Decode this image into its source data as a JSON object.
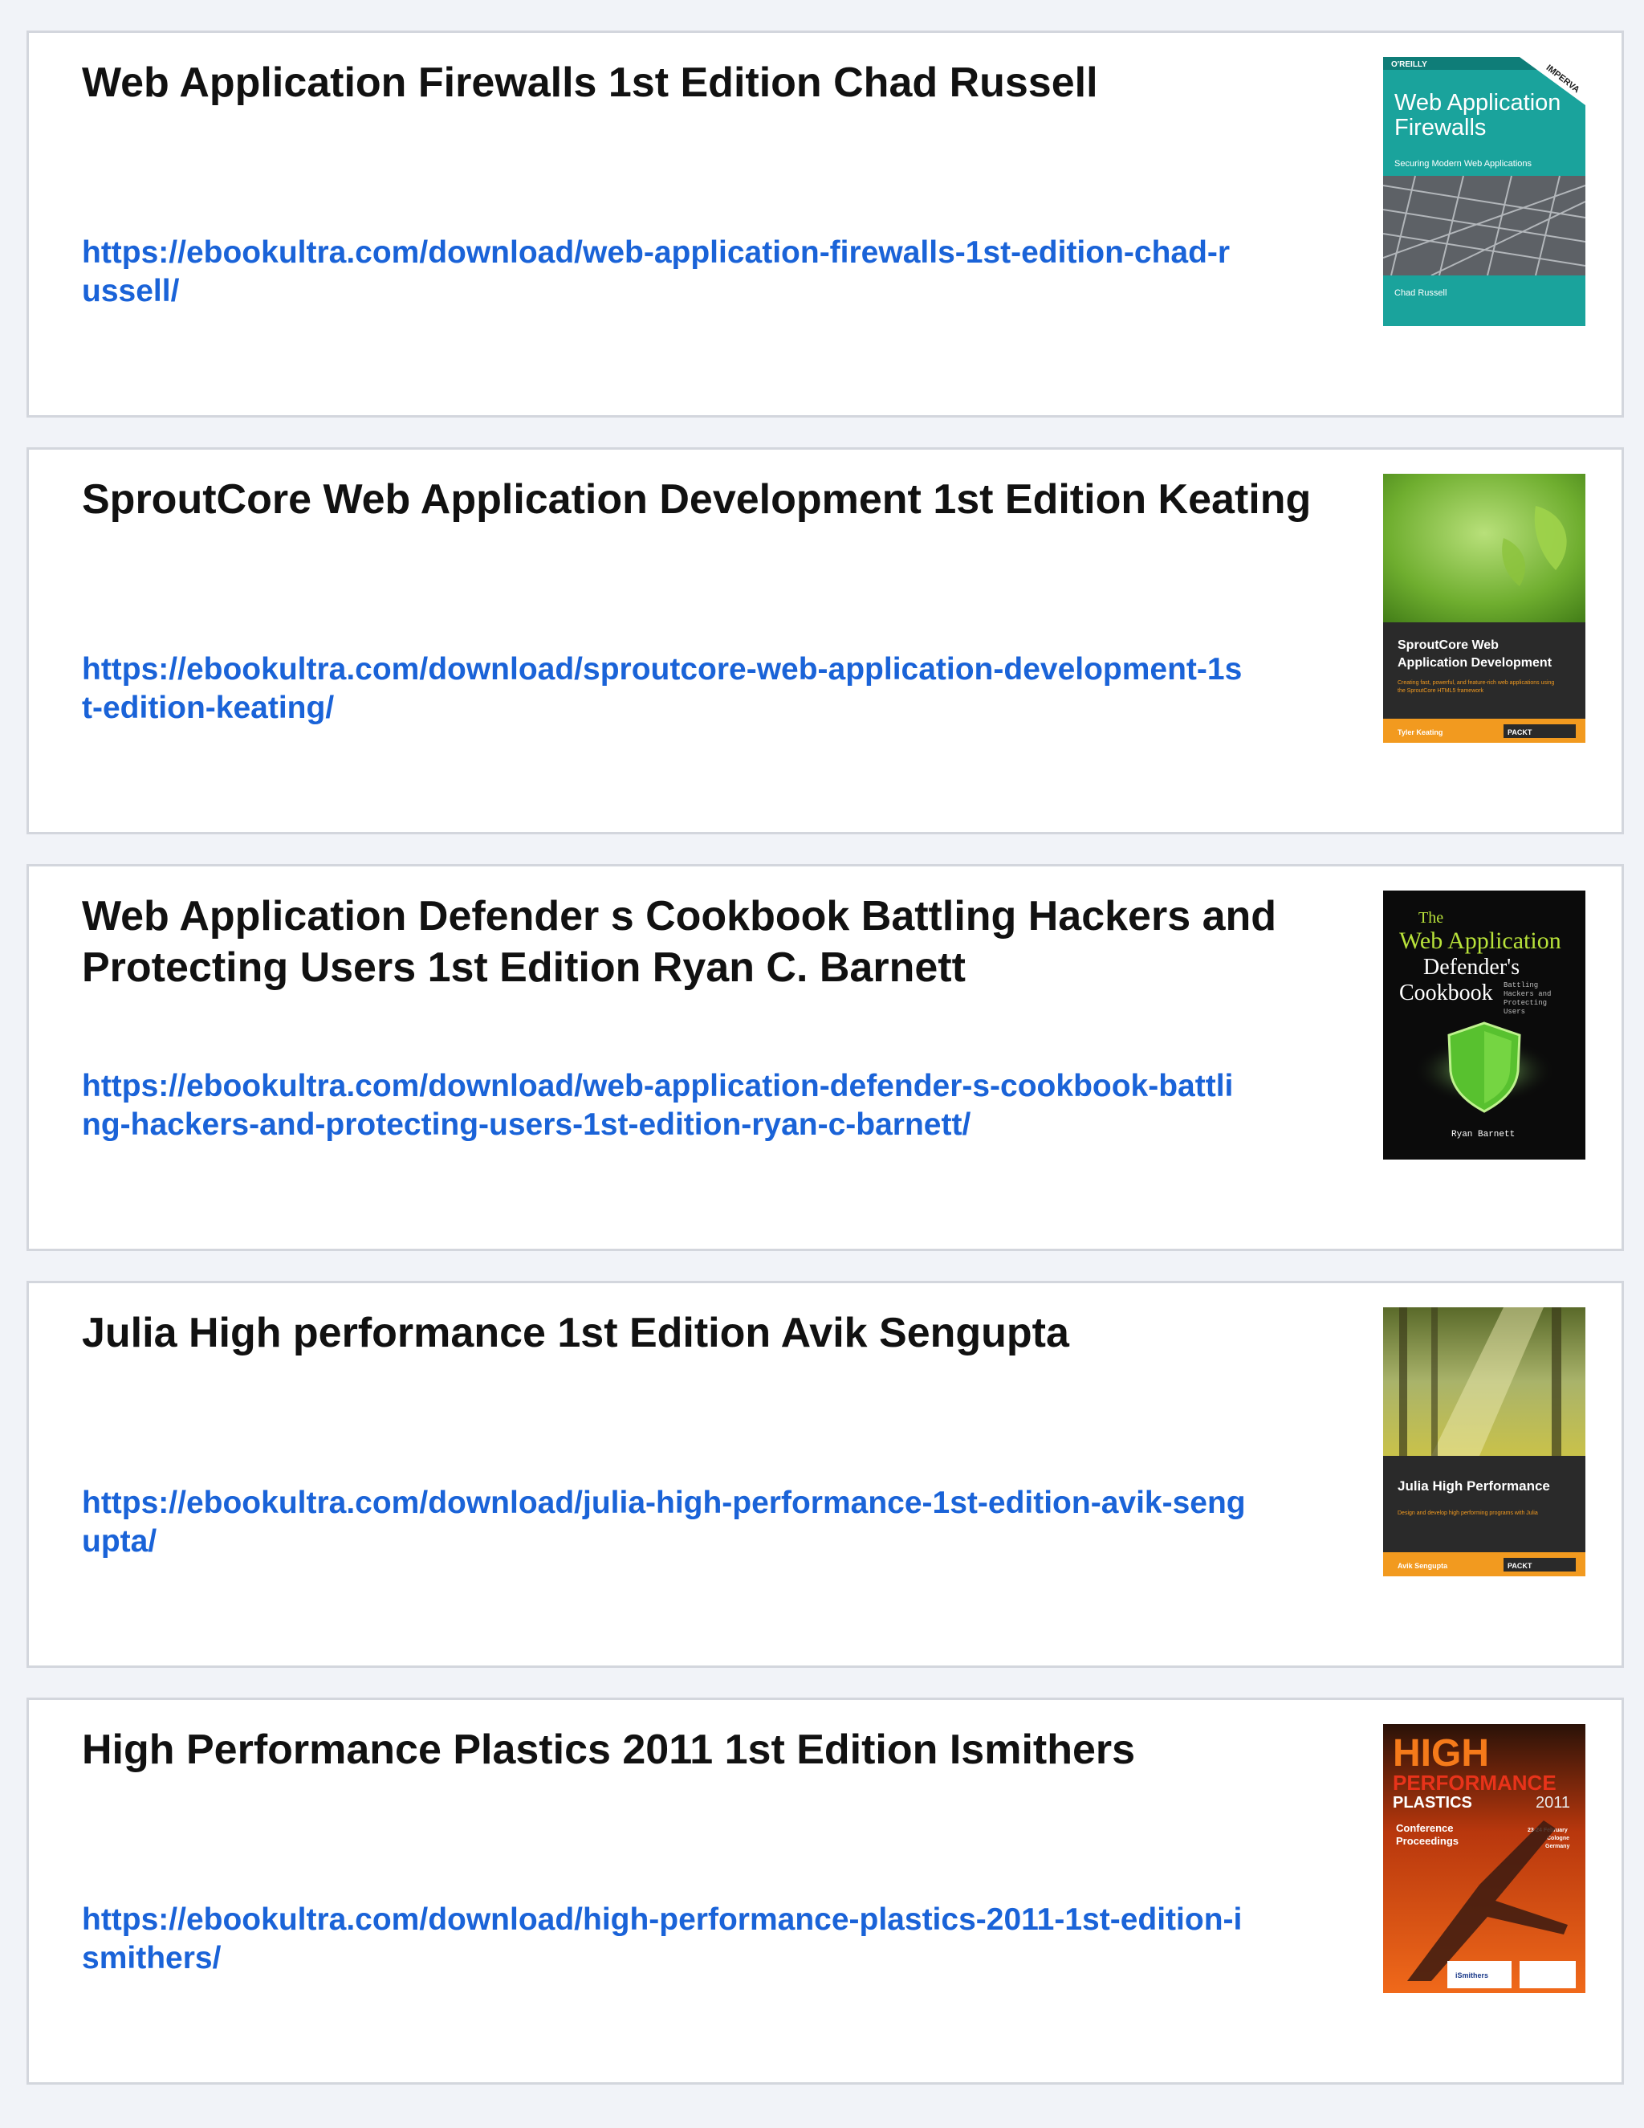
{
  "books": [
    {
      "title": "Web Application Firewalls 1st Edition Chad Russell",
      "url": "https://ebookultra.com/download/web-application-firewalls-1st-edition-chad-russell/",
      "cover": {
        "publisher": "O'REILLY",
        "sponsor": "IMPERVA",
        "title_line1": "Web Application",
        "title_line2": "Firewalls",
        "subtitle": "Securing Modern Web Applications",
        "author": "Chad Russell"
      }
    },
    {
      "title": "SproutCore Web Application Development 1st Edition Keating",
      "url": "https://ebookultra.com/download/sproutcore-web-application-development-1st-edition-keating/",
      "cover": {
        "title_line1": "SproutCore Web",
        "title_line2": "Application Development",
        "subtitle_line1": "Creating fast, powerful, and feature-rich web applications using",
        "subtitle_line2": "the SproutCore HTML5 framework",
        "author": "Tyler Keating",
        "publisher": "PACKT"
      }
    },
    {
      "title": "Web Application Defender s Cookbook Battling Hackers and Protecting Users 1st Edition Ryan C. Barnett",
      "url": "https://ebookultra.com/download/web-application-defender-s-cookbook-battling-hackers-and-protecting-users-1st-edition-ryan-c-barnett/",
      "cover": {
        "the": "The",
        "title_line1": "Web Application",
        "title_line2": "Defender's",
        "title_line3": "Cookbook",
        "side_line1": "Battling",
        "side_line2": "Hackers and",
        "side_line3": "Protecting",
        "side_line4": "Users",
        "author": "Ryan Barnett"
      }
    },
    {
      "title": "Julia High performance 1st Edition Avik Sengupta",
      "url": "https://ebookultra.com/download/julia-high-performance-1st-edition-avik-sengupta/",
      "cover": {
        "title": "Julia High Performance",
        "subtitle": "Design and develop high performing programs with Julia",
        "author": "Avik Sengupta",
        "publisher": "PACKT"
      }
    },
    {
      "title": "High Performance Plastics 2011 1st Edition Ismithers",
      "url": "https://ebookultra.com/download/high-performance-plastics-2011-1st-edition-ismithers/",
      "cover": {
        "line1": "HIGH",
        "line2": "PERFORMANCE",
        "line3": "PLASTICS",
        "year": "2011",
        "conf_line1": "Conference",
        "conf_line2": "Proceedings",
        "dates_line1": "23-24 February",
        "dates_line2": "Cologne",
        "dates_line3": "Germany",
        "publisher": "iSmithers"
      }
    }
  ]
}
